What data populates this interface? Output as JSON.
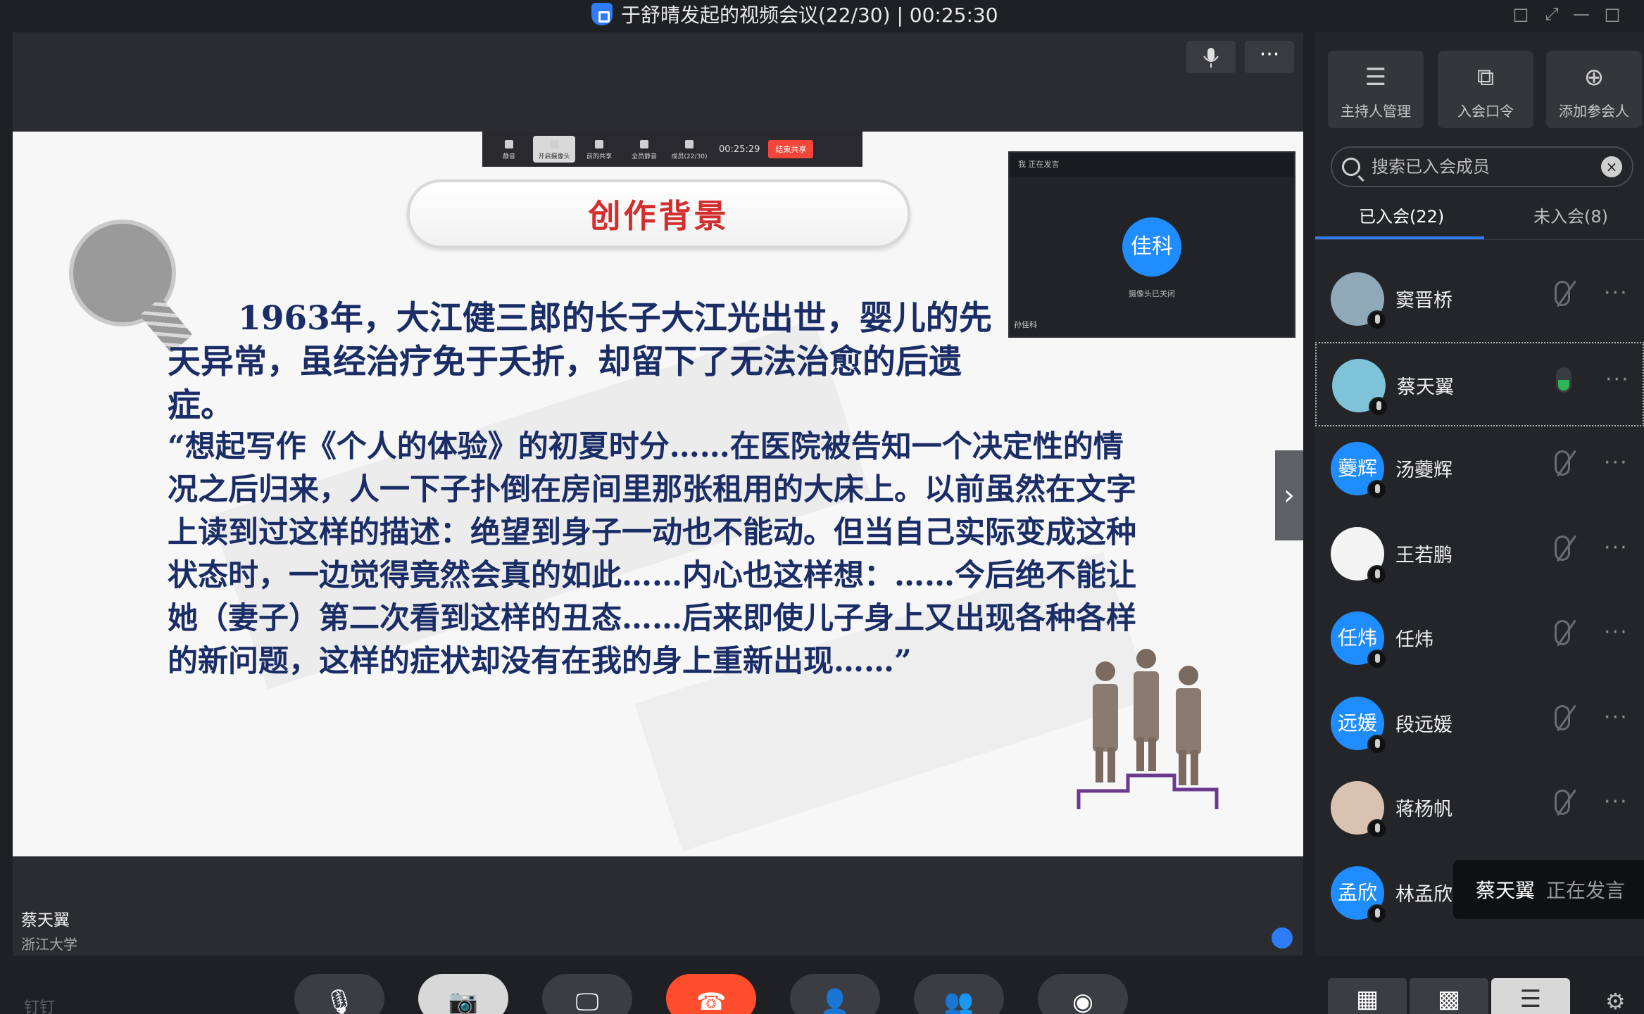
{
  "window": {
    "title": "于舒晴发起的视频会议(22/30) | 00:25:30",
    "controls": [
      "□",
      "⤢",
      "—",
      "□",
      "✕"
    ]
  },
  "stage": {
    "presenter_name": "蔡天翼",
    "presenter_org": "浙江大学"
  },
  "slide": {
    "title": "创作背景",
    "para1": "1963年，大江健三郎的长子大江光出世，婴儿的先天异常，虽经治疗免于夭折，却留下了无法治愈的后遗症。",
    "quote": "“想起写作《个人的体验》的初夏时分……在医院被告知一个决定性的情况之后归来，人一下子扑倒在房间里那张租用的大床上。以前虽然在文字上读到过这样的描述：绝望到身子一动也不能动。但当自己实际变成这种状态时，一边觉得竟然会真的如此……内心也这样想：……今后绝不能让她（妻子）第二次看到这样的丑态……后来即使儿子身上又出现各种各样的新问题，这样的症状却没有在我的身上重新出现……”"
  },
  "mini_toolbar": {
    "buttons": [
      "静音",
      "开启摄像头",
      "前的共享",
      "全员静音",
      "成员(22/30)"
    ],
    "time": "00:25:29",
    "end_share": "结束共享"
  },
  "pip": {
    "header": "我  正在发言",
    "avatar_text": "佳科",
    "camera_off": "摄像头已关闭",
    "name": "孙佳科"
  },
  "panel": {
    "top_buttons": [
      {
        "label": "主持人管理",
        "icon": "sliders-icon"
      },
      {
        "label": "入会口令",
        "icon": "share-out-icon"
      },
      {
        "label": "添加参会人",
        "icon": "add-user-icon"
      }
    ],
    "search_placeholder": "搜索已入会成员",
    "tabs": {
      "joined": "已入会(22)",
      "not_joined": "未入会(8)"
    },
    "members": [
      {
        "name": "窦晋桥",
        "avatar_text": "",
        "avatar_color": "#8fa9b8",
        "mic": "muted"
      },
      {
        "name": "蔡天翼",
        "avatar_text": "",
        "avatar_color": "#7fc3d9",
        "mic": "on"
      },
      {
        "name": "汤虁辉",
        "avatar_text": "虁辉",
        "avatar_color": "#1f8cff",
        "mic": "muted"
      },
      {
        "name": "王若鹏",
        "avatar_text": "",
        "avatar_color": "#f4f4f4",
        "mic": "muted"
      },
      {
        "name": "任炜",
        "avatar_text": "任炜",
        "avatar_color": "#1f8cff",
        "mic": "muted"
      },
      {
        "name": "段远媛",
        "avatar_text": "远媛",
        "avatar_color": "#1f8cff",
        "mic": "muted"
      },
      {
        "name": "蒋杨帆",
        "avatar_text": "",
        "avatar_color": "#d9c2b0",
        "mic": "muted"
      },
      {
        "name": "林孟欣",
        "avatar_text": "孟欣",
        "avatar_color": "#1f8cff",
        "mic": "muted"
      }
    ],
    "more_glyph": "···",
    "speaking_toast": {
      "name": "蔡天翼",
      "status": "正在发言"
    }
  },
  "bottom_toolbar": {
    "brand": "钉钉",
    "buttons": [
      {
        "name": "mic",
        "icon": "🎙"
      },
      {
        "name": "camera",
        "icon": "📷"
      },
      {
        "name": "screen-share",
        "icon": "🖵"
      },
      {
        "name": "hang-up",
        "icon": "☎"
      },
      {
        "name": "add-member",
        "icon": "👤"
      },
      {
        "name": "members",
        "icon": "👥"
      },
      {
        "name": "record",
        "icon": "◉"
      }
    ],
    "view_buttons": [
      "▦",
      "▩",
      "☰"
    ],
    "settings_icon": "⚙"
  }
}
